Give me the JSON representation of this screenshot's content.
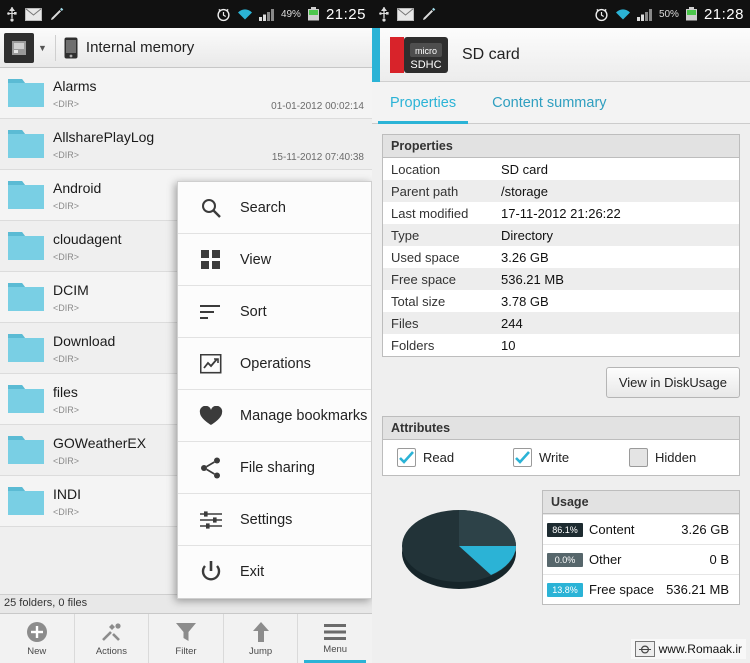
{
  "left": {
    "statusbar": {
      "clock": "21:25",
      "battery_text": "49%",
      "icons": [
        "usb-icon",
        "mail-icon",
        "pen-icon",
        "alarm-icon",
        "wifi-icon",
        "signal-icon",
        "battery-icon"
      ]
    },
    "titlebar": {
      "storage_label": "Internal memory",
      "drive_icon": "drive-icon",
      "phone_icon": "phone-icon",
      "caret_icon": "chevron-down-icon"
    },
    "files": [
      {
        "name": "Alarms",
        "type": "<DIR>",
        "date": "01-01-2012 00:02:14"
      },
      {
        "name": "AllsharePlayLog",
        "type": "<DIR>",
        "date": "15-11-2012 07:40:38"
      },
      {
        "name": "Android",
        "type": "<DIR>",
        "date": ""
      },
      {
        "name": "cloudagent",
        "type": "<DIR>",
        "date": ""
      },
      {
        "name": "DCIM",
        "type": "<DIR>",
        "date": ""
      },
      {
        "name": "Download",
        "type": "<DIR>",
        "date": ""
      },
      {
        "name": "files",
        "type": "<DIR>",
        "date": ""
      },
      {
        "name": "GOWeatherEX",
        "type": "<DIR>",
        "date": ""
      },
      {
        "name": "INDI",
        "type": "<DIR>",
        "date": ""
      }
    ],
    "status_line": "25 folders, 0 files",
    "toolbar": [
      {
        "label": "New",
        "icon": "plus-circle-icon"
      },
      {
        "label": "Actions",
        "icon": "tools-icon"
      },
      {
        "label": "Filter",
        "icon": "funnel-icon"
      },
      {
        "label": "Jump",
        "icon": "up-arrow-icon"
      },
      {
        "label": "Menu",
        "icon": "hamburger-icon",
        "active": true
      }
    ],
    "menu": [
      {
        "label": "Search",
        "icon": "magnifier-icon"
      },
      {
        "label": "View",
        "icon": "grid-icon"
      },
      {
        "label": "Sort",
        "icon": "sort-lines-icon"
      },
      {
        "label": "Operations",
        "icon": "chart-arrow-icon"
      },
      {
        "label": "Manage bookmarks",
        "icon": "heart-icon"
      },
      {
        "label": "File sharing",
        "icon": "share-nodes-icon"
      },
      {
        "label": "Settings",
        "icon": "sliders-icon"
      },
      {
        "label": "Exit",
        "icon": "power-icon"
      }
    ]
  },
  "right": {
    "statusbar": {
      "clock": "21:28",
      "battery_text": "50%",
      "icons": [
        "usb-icon",
        "mail-icon",
        "pen-icon",
        "alarm-icon",
        "wifi-icon",
        "signal-icon",
        "battery-icon"
      ]
    },
    "header": {
      "title": "SD card",
      "card_icon": "microsd-card-icon",
      "card_label": "micro SDHC"
    },
    "tabs": [
      {
        "label": "Properties",
        "active": true
      },
      {
        "label": "Content summary",
        "active": false
      }
    ],
    "properties_panel": {
      "title": "Properties",
      "rows": [
        {
          "key": "Location",
          "value": "SD card"
        },
        {
          "key": "Parent path",
          "value": "/storage"
        },
        {
          "key": "Last modified",
          "value": "17-11-2012 21:26:22"
        },
        {
          "key": "Type",
          "value": "Directory"
        },
        {
          "key": "Used space",
          "value": "3.26 GB"
        },
        {
          "key": "Free space",
          "value": "536.21 MB"
        },
        {
          "key": "Total size",
          "value": "3.78 GB"
        },
        {
          "key": "Files",
          "value": "244"
        },
        {
          "key": "Folders",
          "value": "10"
        }
      ],
      "disk_usage_button": "View in DiskUsage"
    },
    "attributes_panel": {
      "title": "Attributes",
      "items": [
        {
          "label": "Read",
          "checked": true
        },
        {
          "label": "Write",
          "checked": true
        },
        {
          "label": "Hidden",
          "checked": false
        }
      ]
    },
    "usage_panel": {
      "title": "Usage",
      "rows": [
        {
          "pct": "86.1%",
          "name": "Content",
          "value": "3.26 GB",
          "color": "#1d2b30"
        },
        {
          "pct": "0.0%",
          "name": "Other",
          "value": "0 B",
          "color": "#56666b"
        },
        {
          "pct": "13.8%",
          "name": "Free space",
          "value": "536.21 MB",
          "color": "#2bb3d6"
        }
      ]
    },
    "watermark": "www.Romaak.ir"
  },
  "chart_data": {
    "type": "pie",
    "title": "Usage",
    "categories": [
      "Content",
      "Other",
      "Free space"
    ],
    "values": [
      86.1,
      0.0,
      13.8
    ],
    "labels": [
      "3.26 GB",
      "0 B",
      "536.21 MB"
    ],
    "colors": [
      "#1d2b30",
      "#56666b",
      "#2bb3d6"
    ],
    "legend_position": "right"
  }
}
